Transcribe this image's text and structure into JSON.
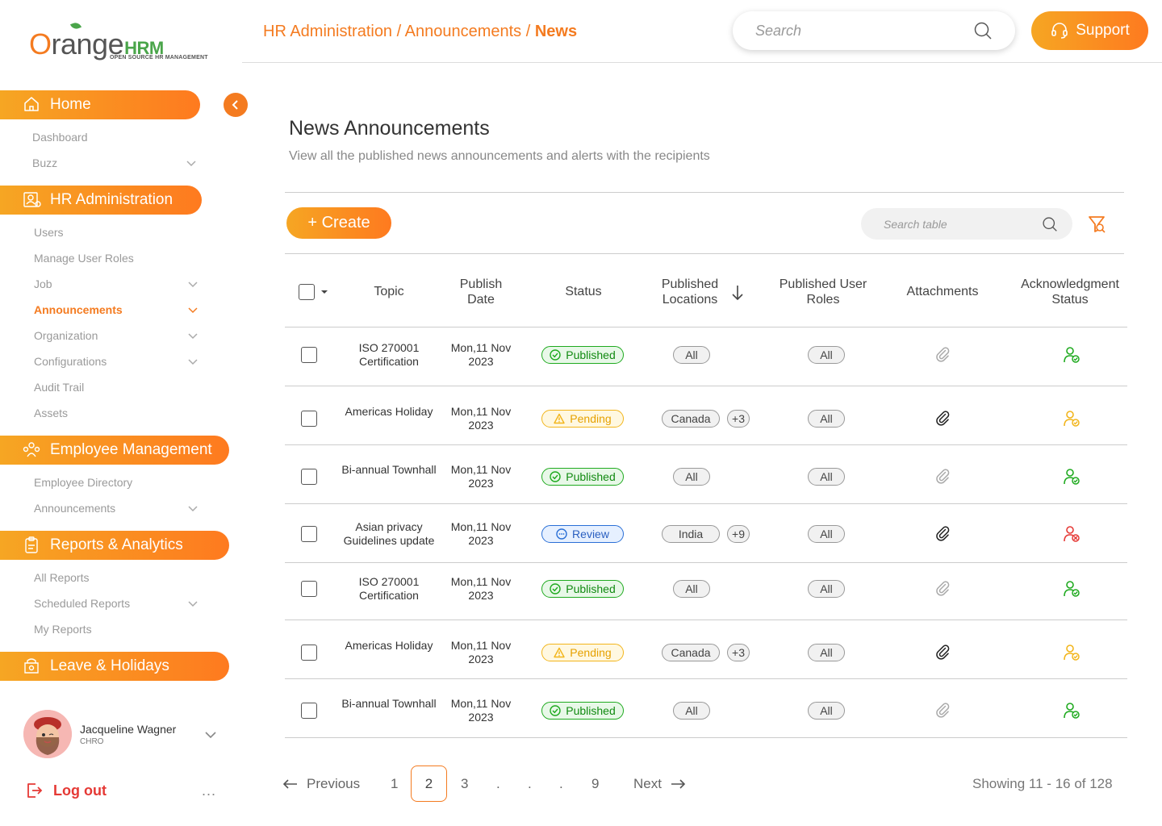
{
  "brand": {
    "logo_main": "range",
    "logo_o": "O",
    "logo_hrm": "HRM",
    "logo_sub": "OPEN SOURCE HR MANAGEMENT"
  },
  "header": {
    "breadcrumb": [
      "HR Administration",
      "Announcements",
      "News"
    ],
    "separator": " / ",
    "search_placeholder": "Search",
    "support_label": "Support"
  },
  "sidebar": {
    "sections": [
      {
        "label": "Home",
        "icon": "home-icon",
        "items": [
          {
            "label": "Dashboard"
          },
          {
            "label": "Buzz",
            "chevron": true
          }
        ]
      },
      {
        "label": "HR Administration",
        "icon": "hr-admin-icon",
        "items": [
          {
            "label": "Users"
          },
          {
            "label": "Manage User Roles"
          },
          {
            "label": "Job",
            "chevron": true
          },
          {
            "label": "Announcements",
            "chevron": true,
            "active": true
          },
          {
            "label": "Organization",
            "chevron": true
          },
          {
            "label": "Configurations",
            "chevron": true
          },
          {
            "label": "Audit Trail"
          },
          {
            "label": "Assets"
          }
        ]
      },
      {
        "label": "Employee Management",
        "icon": "employees-icon",
        "items": [
          {
            "label": "Employee Directory"
          },
          {
            "label": "Announcements",
            "chevron": true
          }
        ]
      },
      {
        "label": "Reports & Analytics",
        "icon": "clipboard-icon",
        "items": [
          {
            "label": "All Reports"
          },
          {
            "label": "Scheduled Reports",
            "chevron": true
          },
          {
            "label": "My Reports"
          }
        ]
      },
      {
        "label": "Leave & Holidays",
        "icon": "leave-icon",
        "items": []
      }
    ],
    "profile": {
      "name": "Jacqueline Wagner",
      "role": "CHRO"
    },
    "logout_label": "Log out",
    "more_label": "..."
  },
  "page": {
    "title": "News Announcements",
    "description": "View all the published news announcements and alerts with the recipients",
    "create_label": "+ Create",
    "table_search_placeholder": "Search table"
  },
  "table": {
    "columns": [
      "Topic",
      "Publish Date",
      "Status",
      "Published Locations",
      "Published User Roles",
      "Attachments",
      "Acknowledgment Status"
    ],
    "rows": [
      {
        "topic": "ISO 270001 Certification",
        "date": "Mon,11 Nov 2023",
        "status": "Published",
        "location": "All",
        "more": "",
        "roles": "All",
        "attachment": "light",
        "ack": "green"
      },
      {
        "topic": "Americas Holiday",
        "date": "Mon,11 Nov 2023",
        "status": "Pending",
        "location": "Canada",
        "more": "+3",
        "roles": "All",
        "attachment": "dark",
        "ack": "yellow"
      },
      {
        "topic": "Bi-annual Townhall",
        "date": "Mon,11 Nov 2023",
        "status": "Published",
        "location": "All",
        "more": "",
        "roles": "All",
        "attachment": "light",
        "ack": "green"
      },
      {
        "topic": "Asian privacy Guidelines update",
        "date": "Mon,11 Nov 2023",
        "status": "Review",
        "location": "India",
        "more": "+9",
        "roles": "All",
        "attachment": "dark",
        "ack": "red"
      },
      {
        "topic": "ISO 270001 Certification",
        "date": "Mon,11 Nov 2023",
        "status": "Published",
        "location": "All",
        "more": "",
        "roles": "All",
        "attachment": "light",
        "ack": "green"
      },
      {
        "topic": "Americas Holiday",
        "date": "Mon,11 Nov 2023",
        "status": "Pending",
        "location": "Canada",
        "more": "+3",
        "roles": "All",
        "attachment": "dark",
        "ack": "yellow"
      },
      {
        "topic": "Bi-annual Townhall",
        "date": "Mon,11 Nov 2023",
        "status": "Published",
        "location": "All",
        "more": "",
        "roles": "All",
        "attachment": "light",
        "ack": "green"
      }
    ]
  },
  "pagination": {
    "previous_label": "Previous",
    "next_label": "Next",
    "pages": [
      "1",
      "2",
      "3",
      ".",
      ".",
      ".",
      "9"
    ],
    "current": "2",
    "showing": "Showing 11 - 16 of 128"
  },
  "colors": {
    "accent": "#f47b20",
    "published": "#1faa1f",
    "pending": "#f2b51b",
    "review": "#2a6fd6",
    "ack_red": "#e53935"
  }
}
